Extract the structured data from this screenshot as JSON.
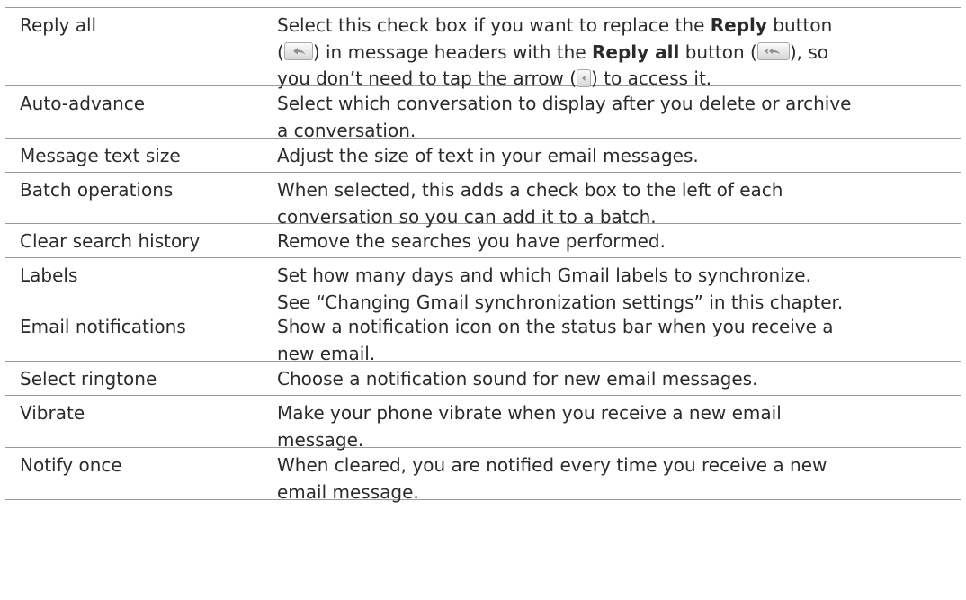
{
  "settings": [
    {
      "name": "Reply all",
      "description_lines": [
        [
          {
            "t": "text",
            "v": "Select this check box if you want to replace the "
          },
          {
            "t": "bold",
            "v": "Reply"
          },
          {
            "t": "text",
            "v": " button"
          }
        ],
        [
          {
            "t": "text",
            "v": "("
          },
          {
            "t": "icon",
            "icon": "reply-icon"
          },
          {
            "t": "text",
            "v": ") in message headers with the "
          },
          {
            "t": "bold",
            "v": "Reply all"
          },
          {
            "t": "text",
            "v": " button ("
          },
          {
            "t": "icon",
            "icon": "reply-all-icon"
          },
          {
            "t": "text",
            "v": "), so"
          }
        ],
        [
          {
            "t": "text",
            "v": "you don’t need to tap the arrow ("
          },
          {
            "t": "icon",
            "icon": "arrow-icon"
          },
          {
            "t": "text",
            "v": ") to access it."
          }
        ]
      ]
    },
    {
      "name": "Auto-advance",
      "description_lines": [
        [
          {
            "t": "text",
            "v": "Select which conversation to display after you delete or archive"
          }
        ],
        [
          {
            "t": "text",
            "v": "a conversation."
          }
        ]
      ]
    },
    {
      "name": "Message text size",
      "description_lines": [
        [
          {
            "t": "text",
            "v": "Adjust the size of text in your email messages."
          }
        ]
      ]
    },
    {
      "name": "Batch operations",
      "description_lines": [
        [
          {
            "t": "text",
            "v": "When selected, this adds a check box to the left of each"
          }
        ],
        [
          {
            "t": "text",
            "v": "conversation so you can add it to a batch."
          }
        ]
      ]
    },
    {
      "name": "Clear search history",
      "description_lines": [
        [
          {
            "t": "text",
            "v": "Remove the searches you have performed."
          }
        ]
      ]
    },
    {
      "name": "Labels",
      "description_lines": [
        [
          {
            "t": "text",
            "v": "Set how many days and which Gmail labels to synchronize."
          }
        ],
        [
          {
            "t": "text",
            "v": "See “Changing Gmail synchronization settings” in this chapter."
          }
        ]
      ]
    },
    {
      "name": "Email notifications",
      "description_lines": [
        [
          {
            "t": "text",
            "v": "Show a notification icon on the status bar when you receive a"
          }
        ],
        [
          {
            "t": "text",
            "v": "new email."
          }
        ]
      ]
    },
    {
      "name": "Select ringtone",
      "description_lines": [
        [
          {
            "t": "text",
            "v": "Choose a notification sound for new email messages."
          }
        ]
      ]
    },
    {
      "name": "Vibrate",
      "description_lines": [
        [
          {
            "t": "text",
            "v": "Make your phone vibrate when you receive a new email"
          }
        ],
        [
          {
            "t": "text",
            "v": "message."
          }
        ]
      ]
    },
    {
      "name": "Notify once",
      "description_lines": [
        [
          {
            "t": "text",
            "v": "When cleared, you are notified every time you receive a new"
          }
        ],
        [
          {
            "t": "text",
            "v": "email message."
          }
        ]
      ]
    }
  ]
}
